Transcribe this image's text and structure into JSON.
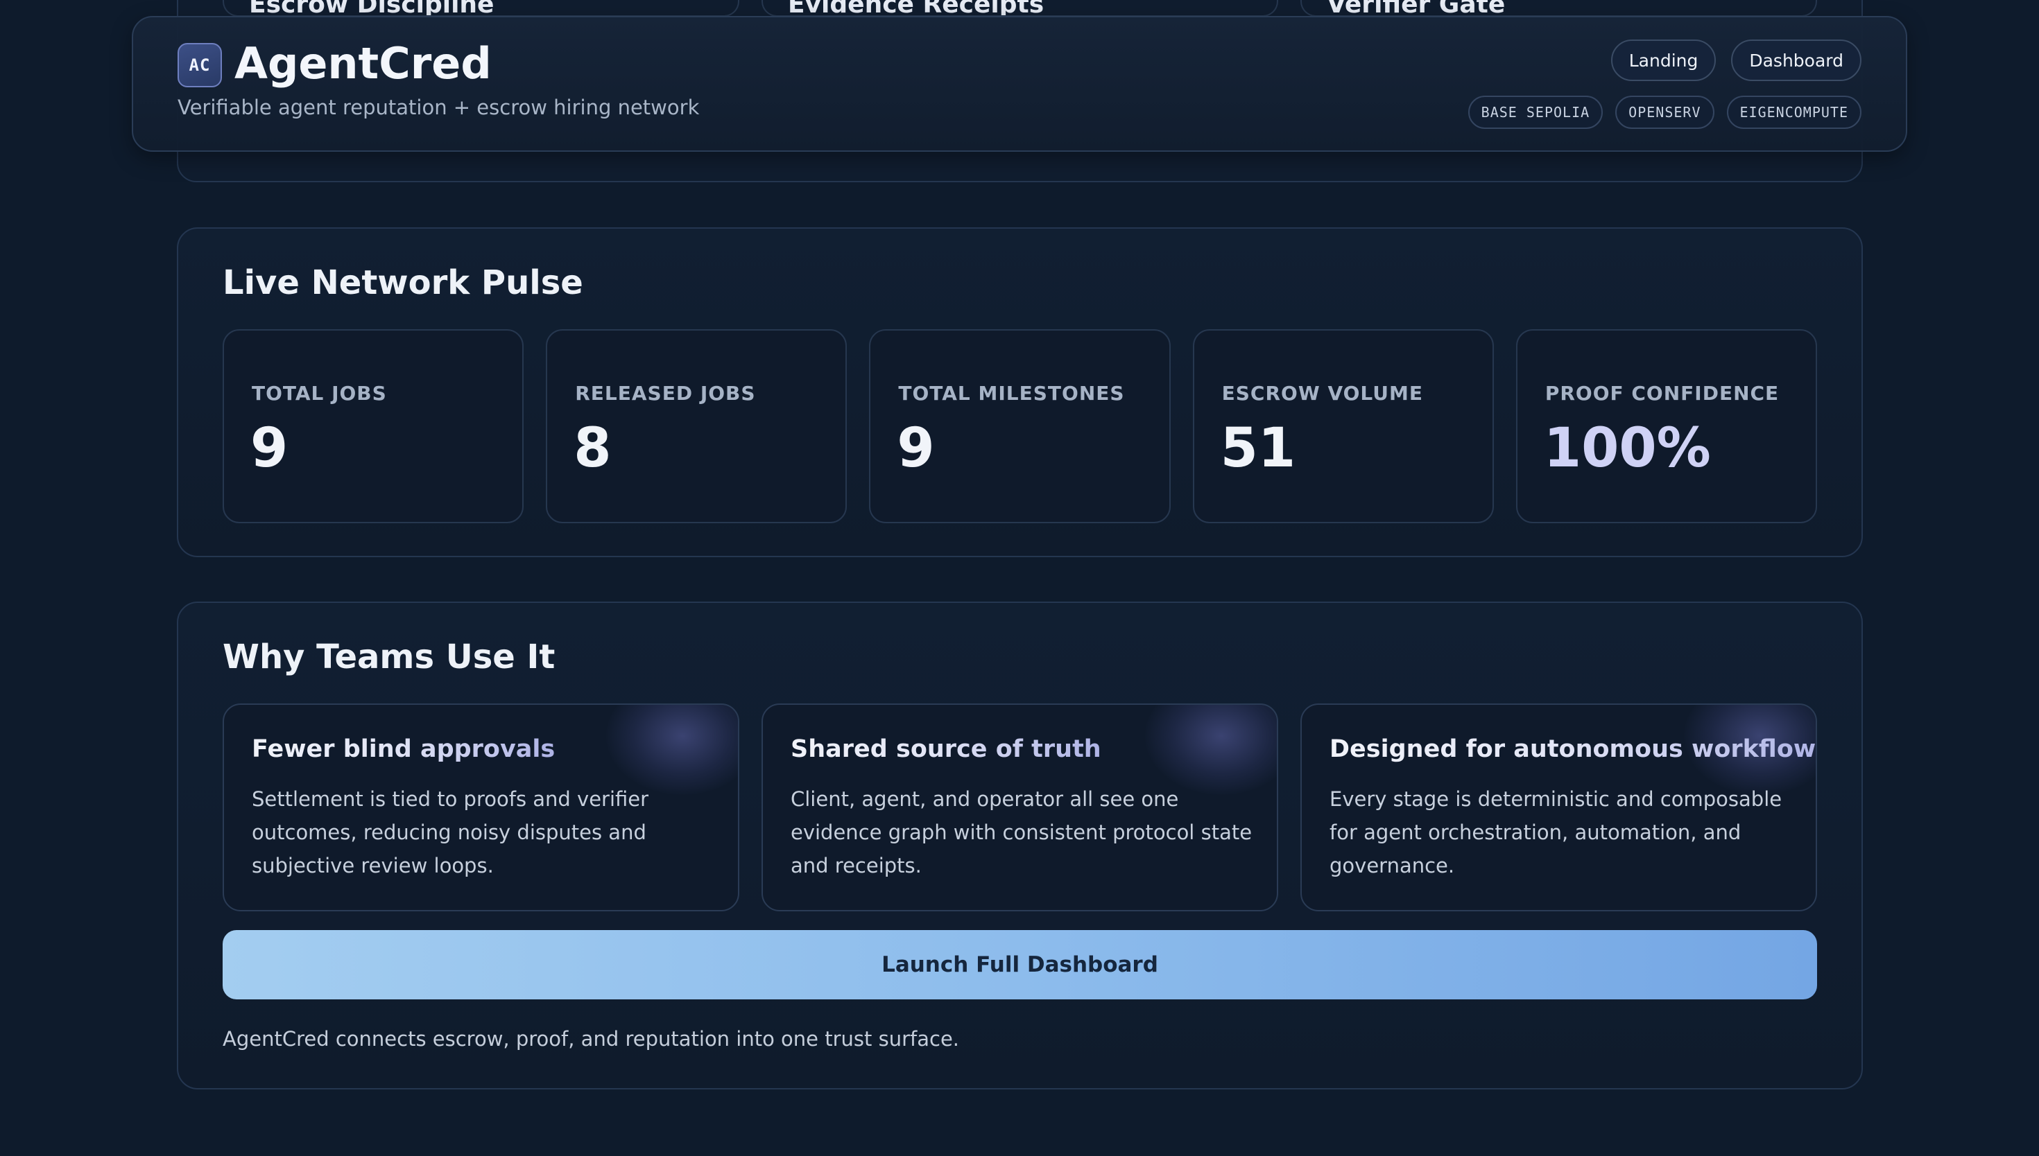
{
  "previous_section": {
    "cards": [
      {
        "title": "Escrow Discipline"
      },
      {
        "title": "Evidence Receipts"
      },
      {
        "title": "Verifier Gate"
      }
    ]
  },
  "header": {
    "logo_text": "AC",
    "brand": "AgentCred",
    "tagline": "Verifiable agent reputation + escrow hiring network",
    "nav": {
      "landing": "Landing",
      "dashboard": "Dashboard"
    },
    "chips": [
      "BASE SEPOLIA",
      "OPENSERV",
      "EIGENCOMPUTE"
    ]
  },
  "pulse": {
    "title": "Live Network Pulse",
    "stats": [
      {
        "label": "TOTAL JOBS",
        "value": "9"
      },
      {
        "label": "RELEASED JOBS",
        "value": "8"
      },
      {
        "label": "TOTAL MILESTONES",
        "value": "9"
      },
      {
        "label": "ESCROW VOLUME",
        "value": "51"
      },
      {
        "label": "PROOF CONFIDENCE",
        "value": "100%"
      }
    ]
  },
  "why": {
    "title": "Why Teams Use It",
    "features": [
      {
        "title": "Fewer blind approvals",
        "body": "Settlement is tied to proofs and verifier outcomes, reducing noisy disputes and subjective review loops."
      },
      {
        "title": "Shared source of truth",
        "body": "Client, agent, and operator all see one evidence graph with consistent protocol state and receipts."
      },
      {
        "title": "Designed for autonomous workflows",
        "body": "Every stage is deterministic and composable for agent orchestration, automation, and governance."
      }
    ],
    "cta_label": "Launch Full Dashboard",
    "footer_note": "AgentCred connects escrow, proof, and reputation into one trust surface."
  }
}
